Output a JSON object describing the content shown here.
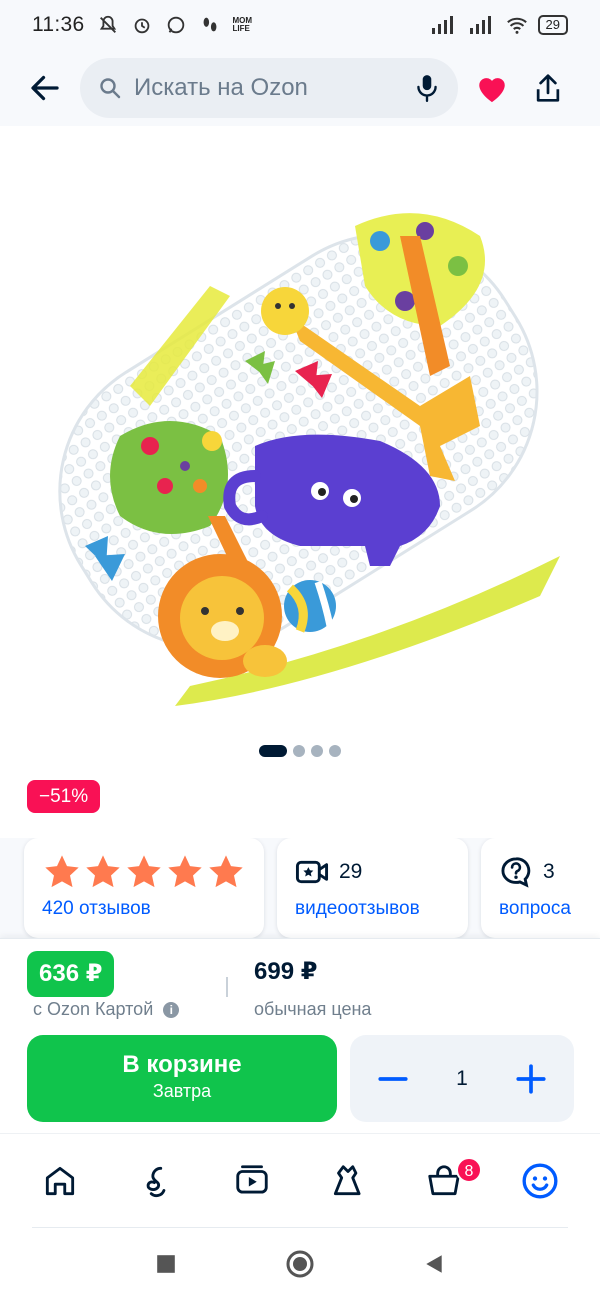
{
  "status_bar": {
    "time": "11:36",
    "mom_life_label": "MOM\nLIFE",
    "battery": "29"
  },
  "header": {
    "search_placeholder": "Искать на Ozon",
    "icons": [
      "arrow-left-icon",
      "search-icon",
      "microphone-icon",
      "heart-icon",
      "share-icon"
    ]
  },
  "gallery": {
    "total_images": 4,
    "active_index": 0
  },
  "discount": "−51%",
  "stats": {
    "rating_stars": 5,
    "reviews": "420 отзывов",
    "video_count": "29",
    "video_reviews": "видеоотзывов",
    "questions_count": "3",
    "questions": "вопроса"
  },
  "price": {
    "ozon_card_price": "636 ₽",
    "ozon_card_label": "с Ozon Картой",
    "regular_price": "699 ₽",
    "regular_label": "обычная цена"
  },
  "cart": {
    "button_label": "В корзине",
    "delivery": "Завтра",
    "quantity": "1"
  },
  "bottom_nav": {
    "items": [
      "home-icon",
      "catalog-icon",
      "video-icon",
      "fashion-icon",
      "cart-icon",
      "profile-icon"
    ],
    "cart_count": "8"
  },
  "colors": {
    "accent_blue": "#005bff",
    "green": "#10c44c",
    "pink": "#f91155",
    "text_dark": "#001a34"
  }
}
